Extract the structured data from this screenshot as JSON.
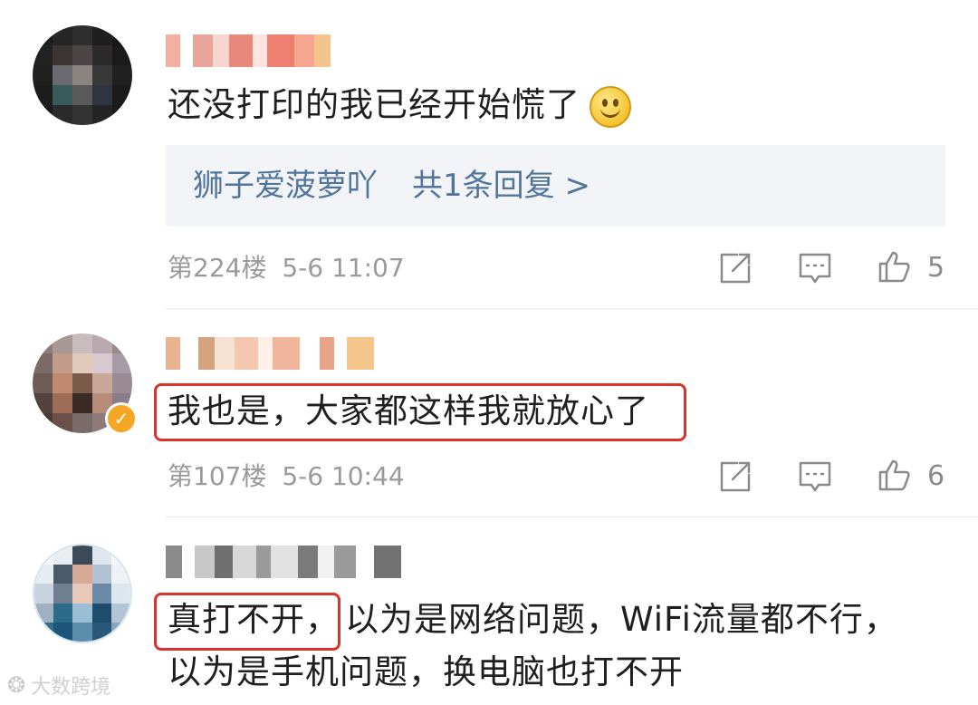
{
  "comments": [
    {
      "text": "还没打印的我已经开始慌了",
      "emoji": "smiley-face-emoji",
      "reply": {
        "user": "狮子爱菠萝吖",
        "count_text": "共1条回复 >"
      },
      "floor": "第224楼",
      "time": "5-6 11:07",
      "likes": "5"
    },
    {
      "text": "我也是，大家都这样我就放心了",
      "verified": true,
      "floor": "第107楼",
      "time": "5-6 10:44",
      "likes": "6"
    },
    {
      "text_highlight": "真打不开，",
      "text_rest": "以为是网络问题，WiFi流量都不行，",
      "text_line2": "以为是手机问题，换电脑也打不开"
    }
  ],
  "colors": {
    "link": "#51759b",
    "highlight_border": "#d8332c",
    "verified_badge": "#f5a623",
    "reply_bg": "#f2f4f7"
  },
  "watermark": {
    "text": "大数跨境"
  }
}
